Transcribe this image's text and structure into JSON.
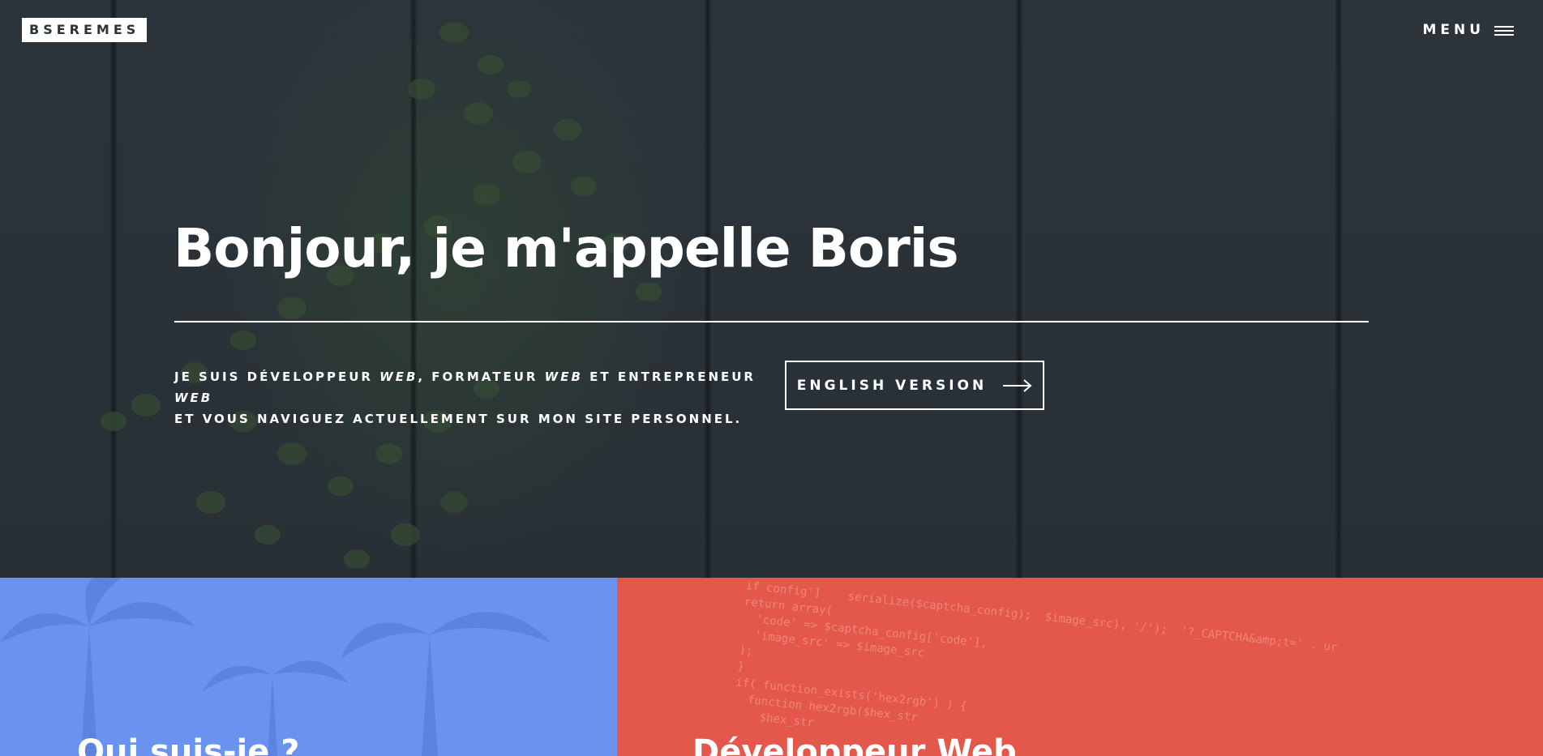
{
  "brand": {
    "logo": "BSEREMES"
  },
  "nav": {
    "menu_label": "MENU"
  },
  "hero": {
    "title": "Bonjour, je m'appelle Boris",
    "intro_line1_parts": [
      "JE SUIS DÉVELOPPEUR ",
      "WEB",
      ", FORMATEUR ",
      "WEB",
      " ET ENTREPRENEUR ",
      "WEB"
    ],
    "intro_line2": "ET VOUS NAVIGUEZ ACTUELLEMENT SUR MON SITE PERSONNEL.",
    "cta_label": "ENGLISH VERSION"
  },
  "panels": {
    "left_title": "Qui suis-je ?",
    "right_title": "Développeur Web",
    "code_snippet": [
      "if config']    serialize($captcha_config);  $image_src), '/');  '?_CAPTCHA&amp;t=' . ur",
      "return array(",
      "  'code' => $captcha_config['code'],",
      "  'image_src' => $image_src",
      ");",
      "}",
      "",
      "",
      "if( function_exists('hex2rgb') ) {",
      "  function hex2rgb($hex_str",
      "    $hex_str"
    ]
  },
  "colors": {
    "hero_bg": "#2c353c",
    "panel_blue": "#6a93f0",
    "panel_red": "#e4574b",
    "text": "#ffffff"
  },
  "icons": {
    "menu": "hamburger-icon",
    "cta": "arrow-right-icon"
  }
}
